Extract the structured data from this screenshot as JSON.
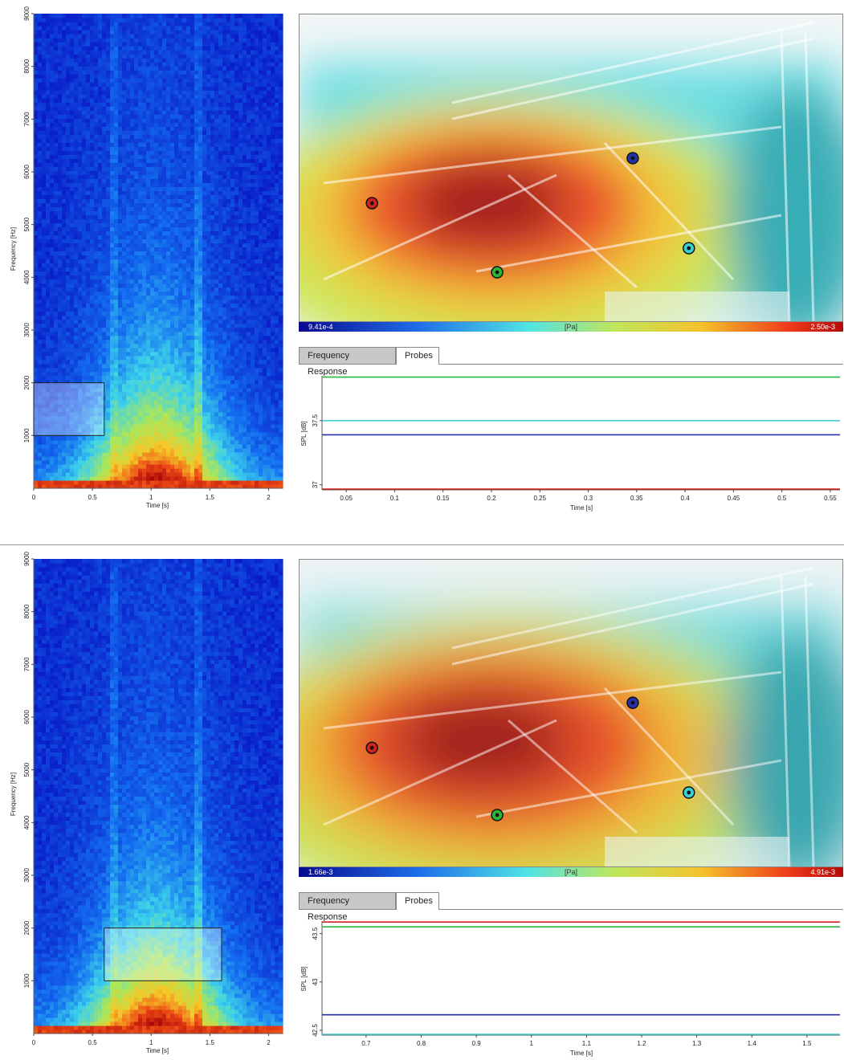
{
  "colors": {
    "probe_red": "#d4201a",
    "probe_blue": "#2431a8",
    "probe_cyan": "#3ad0d6",
    "probe_green": "#2fb53a"
  },
  "panels": [
    {
      "id": "top",
      "spectrogram": {
        "ylabel": "Frequency [Hz]",
        "xlabel": "Time [s]",
        "yticks": [
          "1000",
          "2000",
          "3000",
          "4000",
          "5000",
          "6000",
          "7000",
          "8000",
          "9000"
        ],
        "xticks": [
          "0",
          "0.5",
          "1",
          "1.5",
          "2"
        ],
        "xlim": [
          0,
          2.12
        ],
        "ylim": [
          0,
          9000
        ],
        "selection": {
          "t0": 0,
          "t1": 0.6,
          "f0": 1000,
          "f1": 2000
        }
      },
      "heatmap": {
        "cmin": "9.41e-4",
        "cunit": "[Pa]",
        "cmax": "2.50e-3",
        "probes": [
          {
            "color": "red",
            "u": 0.133,
            "v": 0.612
          },
          {
            "color": "blue",
            "u": 0.612,
            "v": 0.466
          },
          {
            "color": "cyan",
            "u": 0.715,
            "v": 0.758
          },
          {
            "color": "green",
            "u": 0.363,
            "v": 0.836
          }
        ]
      },
      "tabs": {
        "frequency_response": "Frequency Response",
        "probes": "Probes"
      },
      "probe_chart": {
        "type": "line",
        "ylabel": "SPL [dB]",
        "xlabel": "Time [s]",
        "yticks": [
          "37",
          "37.5"
        ],
        "xticks": [
          "0.05",
          "0.1",
          "0.15",
          "0.2",
          "0.25",
          "0.3",
          "0.35",
          "0.4",
          "0.45",
          "0.5",
          "0.55"
        ],
        "xlim": [
          0.025,
          0.56
        ],
        "ylim": [
          36.96,
          37.85
        ],
        "series": [
          {
            "color": "green",
            "value": 37.84
          },
          {
            "color": "cyan",
            "value": 37.5
          },
          {
            "color": "blue",
            "value": 37.39
          },
          {
            "color": "red",
            "value": 36.95
          }
        ]
      }
    },
    {
      "id": "bottom",
      "spectrogram": {
        "ylabel": "Frequency [Hz]",
        "xlabel": "Time [s]",
        "yticks": [
          "1000",
          "2000",
          "3000",
          "4000",
          "5000",
          "6000",
          "7000",
          "8000",
          "9000"
        ],
        "xticks": [
          "0",
          "0.5",
          "1",
          "1.5",
          "2"
        ],
        "xlim": [
          0,
          2.12
        ],
        "ylim": [
          0,
          9000
        ],
        "selection": {
          "t0": 0.6,
          "t1": 1.6,
          "f0": 1000,
          "f1": 2000
        }
      },
      "heatmap": {
        "cmin": "1.66e-3",
        "cunit": "[Pa]",
        "cmax": "4.91e-3",
        "probes": [
          {
            "color": "red",
            "u": 0.133,
            "v": 0.61
          },
          {
            "color": "blue",
            "u": 0.612,
            "v": 0.464
          },
          {
            "color": "cyan",
            "u": 0.715,
            "v": 0.755
          },
          {
            "color": "green",
            "u": 0.363,
            "v": 0.828
          }
        ]
      },
      "tabs": {
        "frequency_response": "Frequency Response",
        "probes": "Probes"
      },
      "probe_chart": {
        "type": "line",
        "ylabel": "SPL [dB]",
        "xlabel": "Time [s]",
        "yticks": [
          "42.5",
          "43",
          "43.5"
        ],
        "xticks": [
          "0.7",
          "0.8",
          "0.9",
          "1",
          "1.1",
          "1.2",
          "1.3",
          "1.4",
          "1.5"
        ],
        "xlim": [
          0.62,
          1.56
        ],
        "ylim": [
          42.45,
          43.63
        ],
        "series": [
          {
            "color": "red",
            "value": 43.62
          },
          {
            "color": "green",
            "value": 43.57
          },
          {
            "color": "blue",
            "value": 42.66
          },
          {
            "color": "cyan",
            "value": 42.44
          }
        ]
      }
    }
  ]
}
